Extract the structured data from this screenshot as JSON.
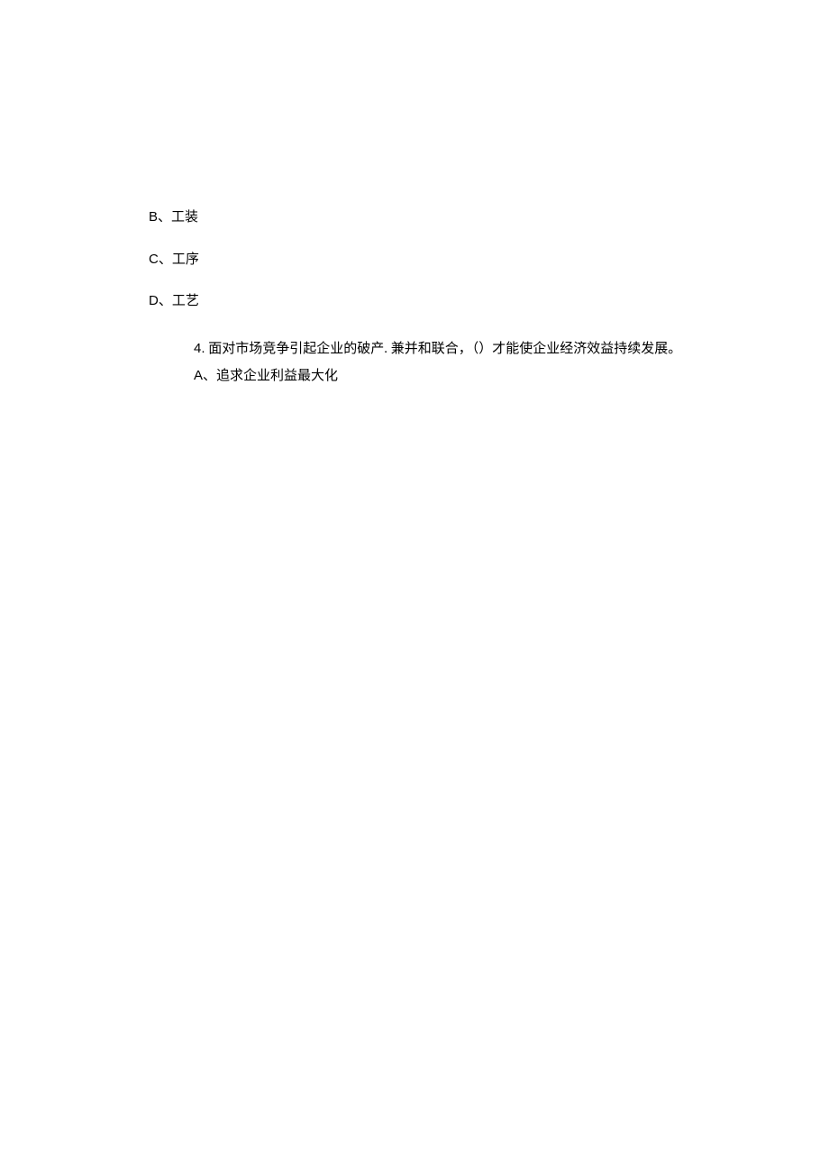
{
  "options_top": [
    {
      "label": "B、",
      "text": "工装"
    },
    {
      "label": "C、",
      "text": "工序"
    },
    {
      "label": "D、",
      "text": "工艺"
    }
  ],
  "question": {
    "number": "4.",
    "text": " 面对市场竞争引起企业的破产. 兼并和联合，（）才能使企业经济效益持续发展。"
  },
  "option_a": {
    "label": "A、",
    "text": "追求企业利益最大化"
  }
}
